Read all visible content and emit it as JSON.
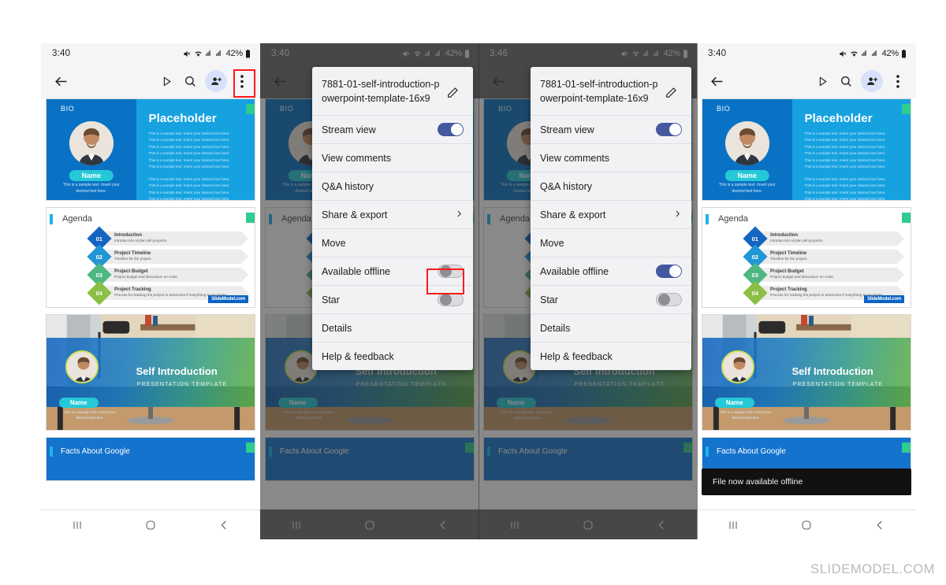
{
  "watermark": "SLIDEMODEL.COM",
  "status": {
    "time_340": "3:40",
    "time_346": "3:46",
    "battery": "42%",
    "icons": [
      "mute-icon",
      "wifi-icon",
      "signal-icon",
      "signal-icon",
      "battery-icon"
    ]
  },
  "toolbar": {
    "back": "back-arrow-icon",
    "present": "present-icon",
    "search": "search-icon",
    "add_person": "add-person-icon",
    "overflow": "overflow-menu-icon"
  },
  "navbar": {
    "recents": "recents-icon",
    "home": "home-icon",
    "back": "back-icon"
  },
  "slides": {
    "bio": {
      "label": "BIO",
      "title": "Placeholder",
      "name_pill": "Name",
      "left_note": "This is a sample text. Insert your desired text here.",
      "body_line": "This is a sample text. Insert your desired text here.",
      "body_lines_block1": 6,
      "body_lines_block2": 6
    },
    "agenda": {
      "title": "Agenda",
      "logo": "SlideModel.com",
      "items": [
        {
          "num": "01",
          "heading": "Introduction",
          "desc": "Introducción al plan del proyecto.",
          "color": "#1565c0"
        },
        {
          "num": "02",
          "heading": "Project Timeline",
          "desc": "Timeline for the project.",
          "color": "#2196d6"
        },
        {
          "num": "03",
          "heading": "Project Budget",
          "desc": "Project budget and discussion on costs.",
          "color": "#4fb783"
        },
        {
          "num": "04",
          "heading": "Project Tracking",
          "desc": "Process for tracking the project to determine if everything is on course.",
          "color": "#8cbf45"
        }
      ]
    },
    "cover": {
      "title": "Self Introduction",
      "subtitle": "PRESENTATION TEMPLATE",
      "name_pill": "Name",
      "note": "This is a sample text. Insert your desired text here."
    },
    "facts": {
      "title": "Facts About Google"
    }
  },
  "menu": {
    "doc_title": "7881-01-self-introduction-powerpoint-template-16x9",
    "edit_icon": "pencil-icon",
    "items": [
      {
        "label": "Stream view",
        "control": "toggle",
        "state_panel2": "on",
        "state_panel3": "on"
      },
      {
        "label": "View comments",
        "control": "none"
      },
      {
        "label": "Q&A history",
        "control": "none"
      },
      {
        "label": "Share & export",
        "control": "chevron"
      },
      {
        "label": "Move",
        "control": "none"
      },
      {
        "label": "Available offline",
        "control": "toggle",
        "state_panel2": "off",
        "state_panel3": "on"
      },
      {
        "label": "Star",
        "control": "toggle",
        "state_panel2": "off",
        "state_panel3": "off"
      },
      {
        "label": "Details",
        "control": "none"
      },
      {
        "label": "Help & feedback",
        "control": "none"
      }
    ]
  },
  "toast": {
    "message": "File now available offline"
  },
  "colors": {
    "toggle_on": "#4458a0",
    "toggle_off": "#dcdce0",
    "highlight": "#ff1a1a",
    "badge_green": "#2ecc8f",
    "facts_blue": "#1473cc"
  }
}
